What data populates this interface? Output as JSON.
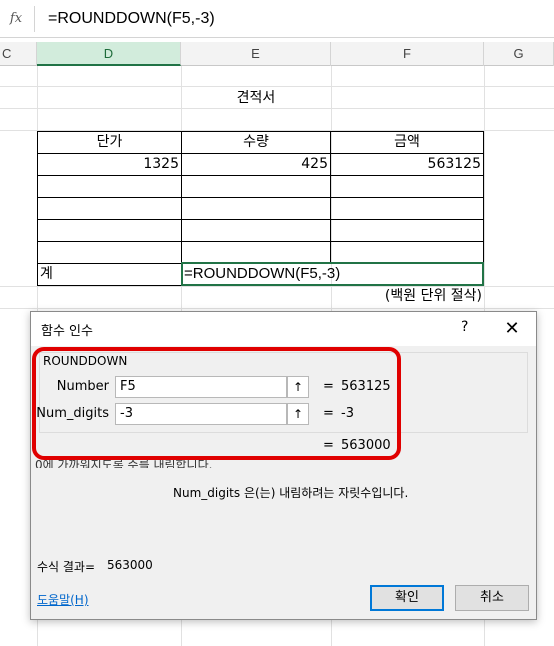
{
  "formula_bar": {
    "fx_label": "fx",
    "formula": "=ROUNDDOWN(F5,-3)"
  },
  "columns": [
    "C",
    "D",
    "E",
    "F",
    "G"
  ],
  "sheet": {
    "title": "견적서",
    "headers": [
      "단가",
      "수량",
      "금액"
    ],
    "row1": [
      "1325",
      "425",
      "563125"
    ],
    "total_label": "계",
    "total_formula": "=ROUNDDOWN(F5,-3)",
    "note": "(백원 단위 절삭)"
  },
  "dialog": {
    "title": "함수 인수",
    "help_glyph": "?",
    "close_glyph": "✕",
    "function_name": "ROUNDDOWN",
    "args": [
      {
        "label": "Number",
        "value": "F5",
        "eq": "=",
        "result": "563125"
      },
      {
        "label": "Num_digits",
        "value": "-3",
        "eq": "=",
        "result": "-3"
      }
    ],
    "total_eq": "=",
    "total_result": "563000",
    "arg_button_glyph": "↑",
    "description_partial": "0에 가까워지도록 수를 내림합니다.",
    "arg_description": "Num_digits  은(는) 내림하려는 자릿수입니다.",
    "formula_result_label": "수식 결과=",
    "formula_result_value": "563000",
    "help_link": "도움말(H)",
    "ok_label": "확인",
    "cancel_label": "취소"
  },
  "colors": {
    "accent": "#217346",
    "highlight": "#e00000",
    "focus": "#0078d7"
  }
}
